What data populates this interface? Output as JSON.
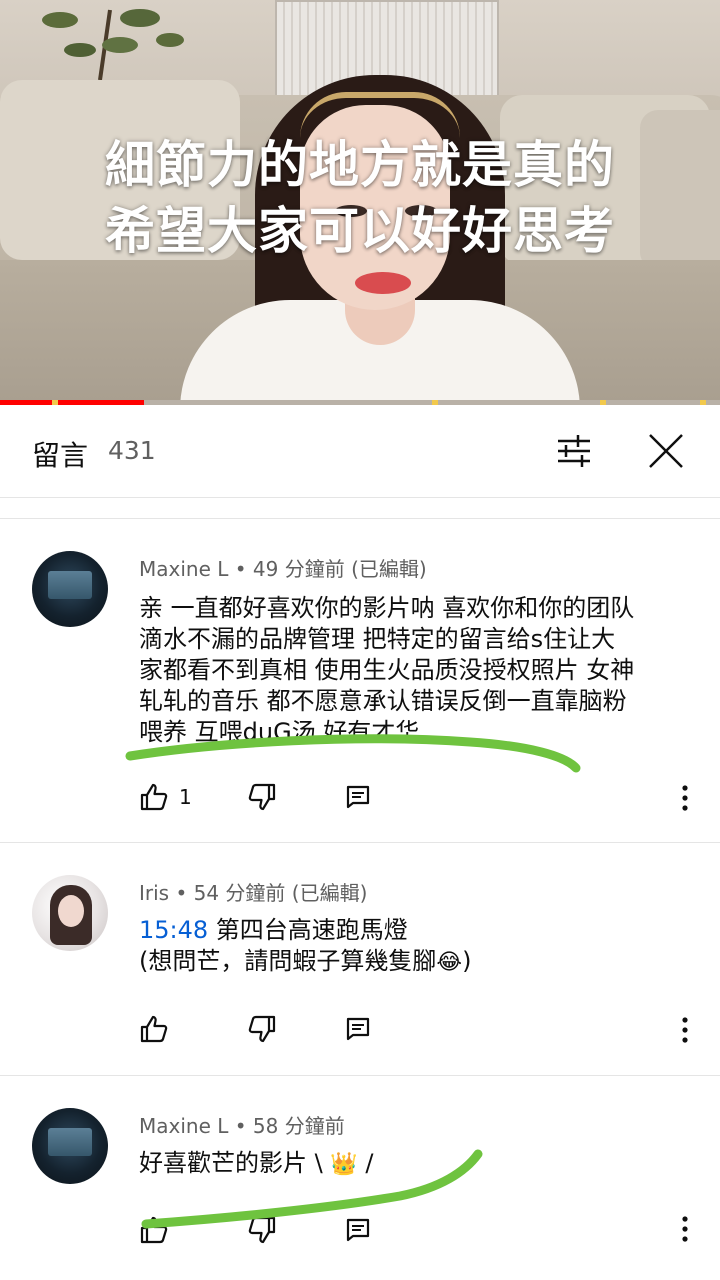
{
  "video": {
    "subtitle_line1": "細節力的地方就是真的",
    "subtitle_line2": "希望大家可以好好思考",
    "progress": 0.2
  },
  "comments_header": {
    "title": "留言",
    "count": "431",
    "filter_icon": "sliders-icon",
    "close_icon": "close-icon"
  },
  "comments": [
    {
      "author": "Maxine L",
      "time": "49 分鐘前 (已編輯)",
      "text_lines": [
        "亲 一直都好喜欢你的影片呐 喜欢你和你的团队",
        "滴水不漏的品牌管理 把特定的留言给s住让大",
        "家都看不到真相 使用生火品质没授权照片 女神",
        "轧轧的音乐 都不愿意承认错误反倒一直靠脑粉",
        "喂养 互喂duG汤 好有才华"
      ],
      "likes": "1",
      "avatar": "dark-screen-avatar"
    },
    {
      "author": "Iris",
      "time": "54 分鐘前 (已編輯)",
      "timestamp": "15:48",
      "text_line1_rest": " 第四台高速跑馬燈",
      "text_line2": "(想問芒，請問蝦子算幾隻腳",
      "text_line2_emoji": "😂",
      "text_line2_end": ")",
      "likes": "",
      "avatar": "portrait-avatar"
    },
    {
      "author": "Maxine L",
      "time": "58 分鐘前",
      "text_start": "好喜歡芒的影片 \\ ",
      "text_emoji": "👑",
      "text_end": " /",
      "likes": "",
      "avatar": "dark-screen-avatar"
    }
  ],
  "separator": "•",
  "colors": {
    "accent_red": "#ff0000",
    "link_blue": "#065fd4",
    "highlight_green": "#6fc33f",
    "meta_gray": "#606060"
  }
}
